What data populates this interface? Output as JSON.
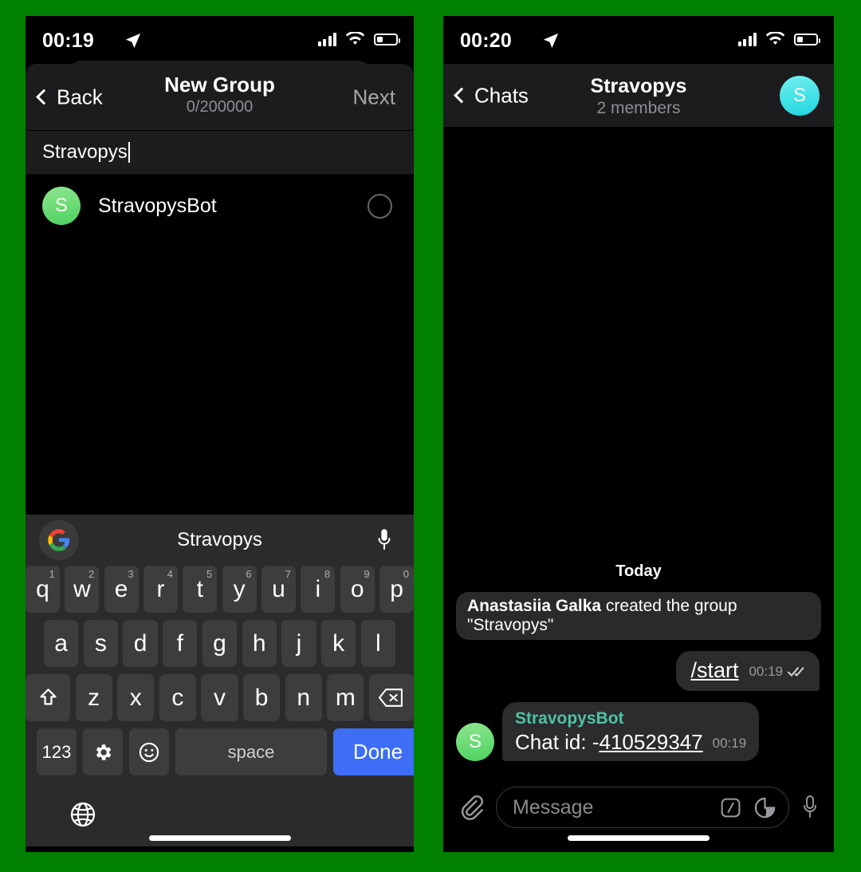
{
  "theme": {
    "page_background": "#008000",
    "phone_background": "#000000",
    "nav_background": "#1c1c1e",
    "key_background": "#3d3d3d",
    "done_key_color": "#3d6ef5",
    "bot_name_color": "#4fc3a1",
    "bubble_color": "#2c2c2e"
  },
  "left_phone": {
    "status_bar": {
      "time": "00:19",
      "location_icon": "location-arrow-icon",
      "signal_icon": "signal-bars-icon",
      "wifi_icon": "wifi-icon",
      "battery_icon": "battery-low-icon"
    },
    "nav": {
      "back_label": "Back",
      "back_icon": "chevron-left-icon",
      "title": "New Group",
      "subtitle": "0/200000",
      "next_label": "Next"
    },
    "search": {
      "value": "Stravopys"
    },
    "contacts": [
      {
        "avatar_letter": "S",
        "name": "StravopysBot",
        "selected": false
      }
    ],
    "keyboard": {
      "suggestion": "Stravopys",
      "google_icon": "google-logo-icon",
      "mic_icon": "microphone-icon",
      "row1": [
        {
          "key": "q",
          "num": "1"
        },
        {
          "key": "w",
          "num": "2"
        },
        {
          "key": "e",
          "num": "3"
        },
        {
          "key": "r",
          "num": "4"
        },
        {
          "key": "t",
          "num": "5"
        },
        {
          "key": "y",
          "num": "6"
        },
        {
          "key": "u",
          "num": "7"
        },
        {
          "key": "i",
          "num": "8"
        },
        {
          "key": "o",
          "num": "9"
        },
        {
          "key": "p",
          "num": "0"
        }
      ],
      "row2": [
        "a",
        "s",
        "d",
        "f",
        "g",
        "h",
        "j",
        "k",
        "l"
      ],
      "row3": [
        "z",
        "x",
        "c",
        "v",
        "b",
        "n",
        "m"
      ],
      "shift_icon": "shift-arrow-icon",
      "backspace_icon": "backspace-icon",
      "numeric_label": "123",
      "settings_icon": "gear-icon",
      "emoji_icon": "smiley-icon",
      "space_label": "space",
      "done_label": "Done",
      "globe_icon": "globe-icon"
    }
  },
  "right_phone": {
    "status_bar": {
      "time": "00:20",
      "location_icon": "location-arrow-icon",
      "signal_icon": "signal-bars-icon",
      "wifi_icon": "wifi-icon",
      "battery_icon": "battery-low-icon"
    },
    "nav": {
      "back_label": "Chats",
      "back_icon": "chevron-left-icon",
      "title": "Stravopys",
      "subtitle": "2 members",
      "avatar_letter": "S"
    },
    "chat": {
      "day_label": "Today",
      "service_message": {
        "actor": "Anastasiia Galka",
        "text": " created the group \"Stravopys\""
      },
      "outgoing": {
        "text": "/start",
        "time": "00:19",
        "status_icon": "double-check-icon"
      },
      "incoming": {
        "avatar_letter": "S",
        "sender": "StravopysBot",
        "text_prefix": "Chat id: -",
        "text_link": "410529347",
        "time": "00:19"
      }
    },
    "input_bar": {
      "attach_icon": "paperclip-icon",
      "placeholder": "Message",
      "command_icon": "slash-command-icon",
      "sticker_icon": "sticker-icon",
      "mic_icon": "microphone-icon"
    }
  }
}
